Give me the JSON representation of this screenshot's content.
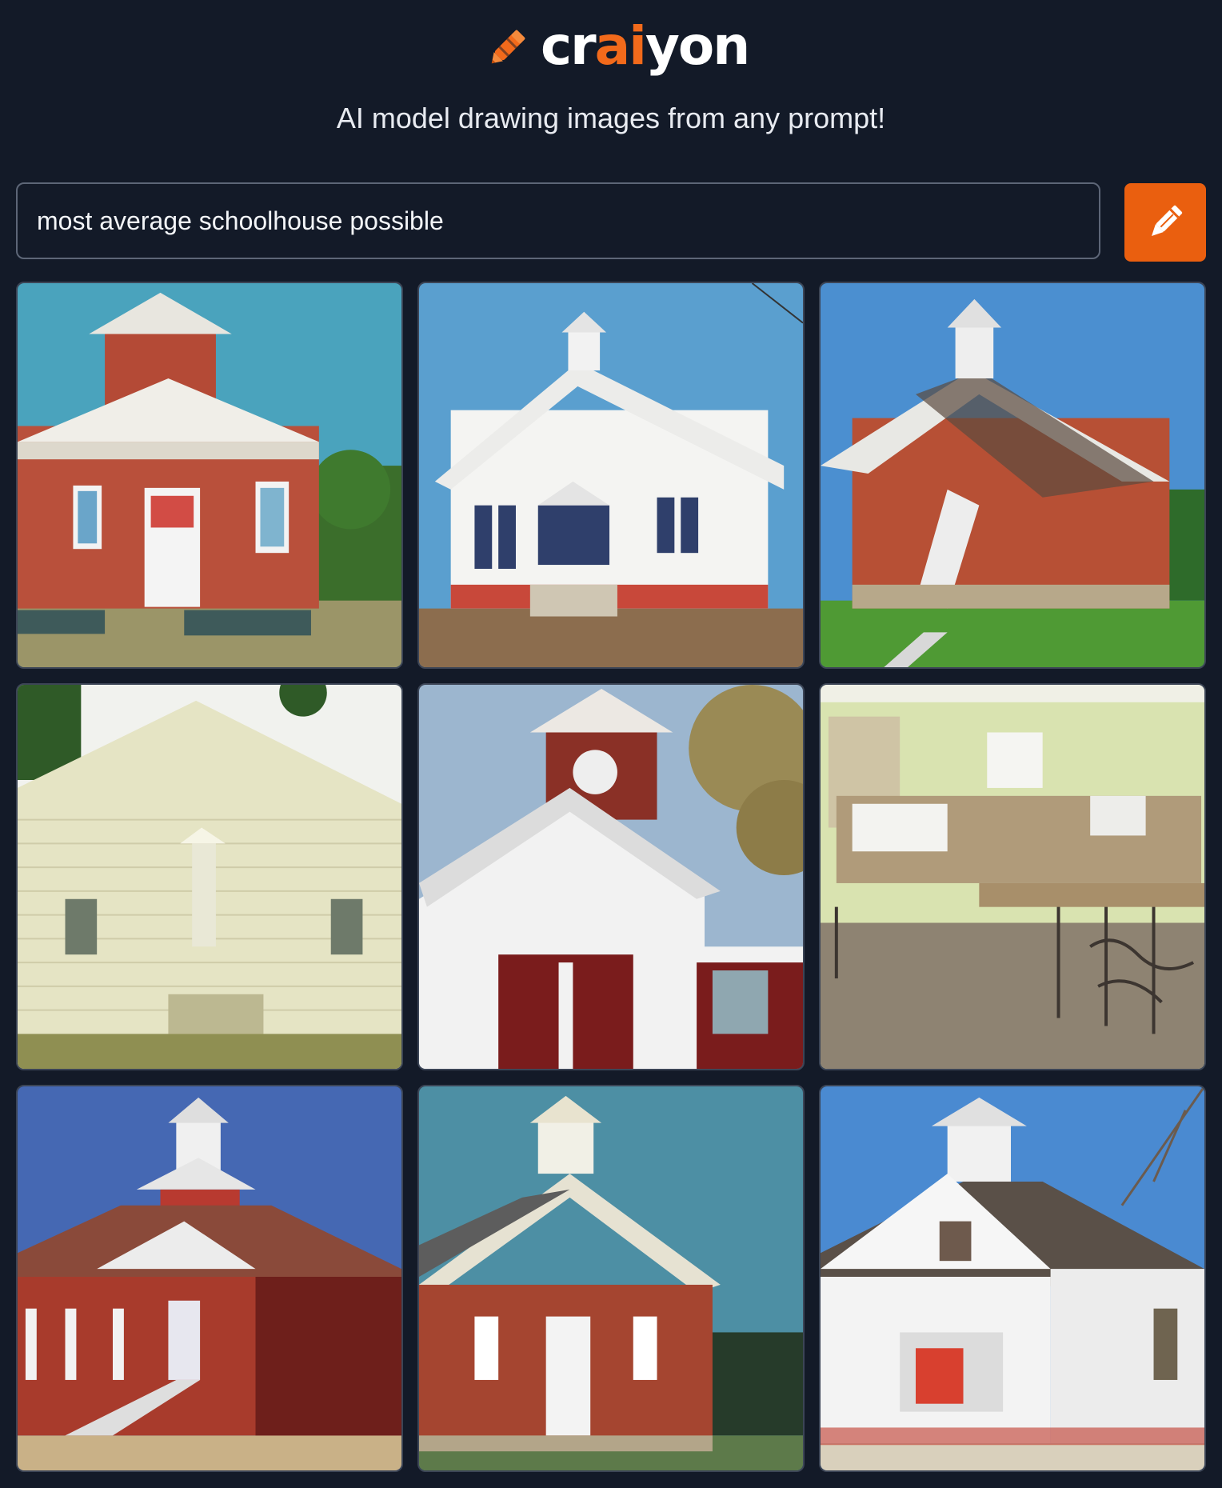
{
  "header": {
    "logo_prefix": "cr",
    "logo_highlight": "ai",
    "logo_suffix": "yon",
    "tagline": "AI model drawing images from any prompt!",
    "brand_color": "#f26a1b"
  },
  "prompt": {
    "value": "most average schoolhouse possible",
    "draw_button_icon": "pencil-icon",
    "button_color": "#ea5f0f"
  },
  "results": [
    {
      "subject": "red brick schoolhouse with white pediment and square tower"
    },
    {
      "subject": "white clapboard schoolhouse with bell cupola"
    },
    {
      "subject": "red brick schoolhouse with cupola and twisted white stair"
    },
    {
      "subject": "cream siding schoolhouse gable front"
    },
    {
      "subject": "white schoolhouse with red belfry and red doors"
    },
    {
      "subject": "empty classroom interior with desks"
    },
    {
      "subject": "red schoolhouse with white trim and cupola"
    },
    {
      "subject": "red brick schoolhouse with white cupola"
    },
    {
      "subject": "white schoolhouse with belfry and red door"
    }
  ]
}
